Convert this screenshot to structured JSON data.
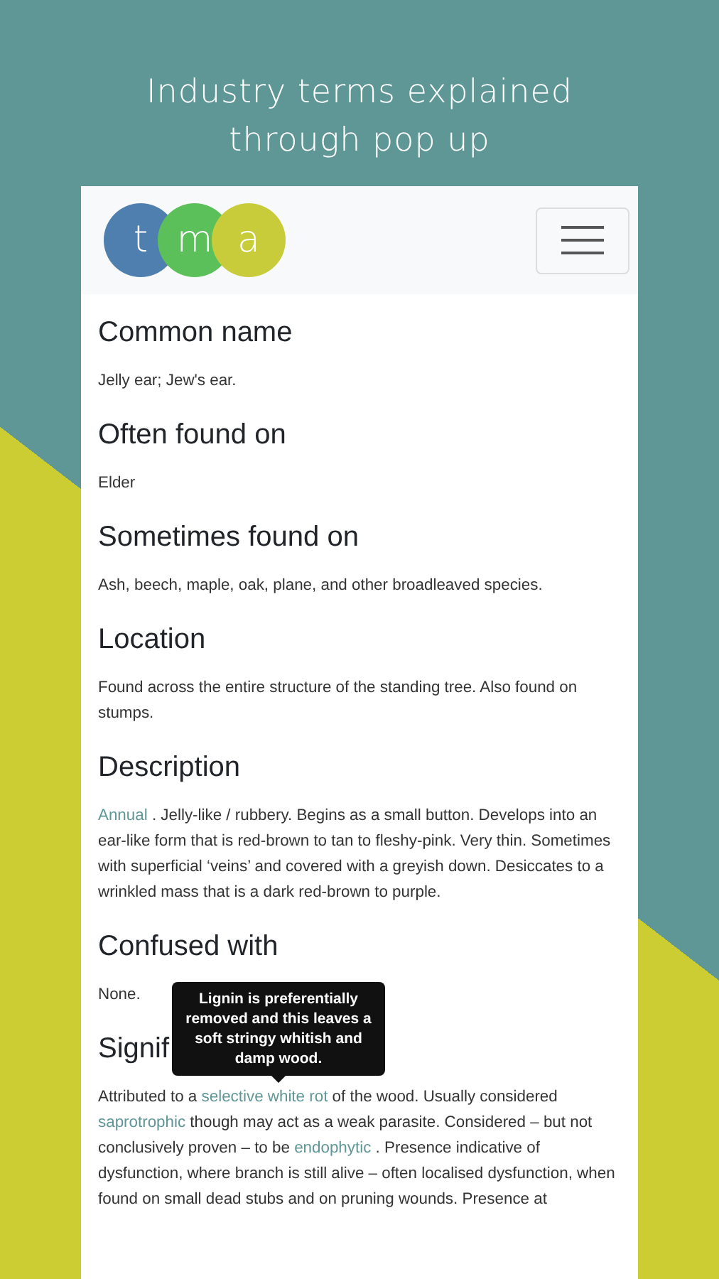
{
  "header": {
    "lines": [
      "Industry terms explained",
      "through pop up"
    ]
  },
  "logo": {
    "letters": [
      {
        "letter": "t",
        "color": "#4f7fae"
      },
      {
        "letter": "m",
        "color": "#5cc05a"
      },
      {
        "letter": "a",
        "color": "#c9cc3a"
      }
    ]
  },
  "sections": [
    {
      "heading": "Common name",
      "body": [
        {
          "text": "Jelly ear; Jew's ear.",
          "link": false
        }
      ]
    },
    {
      "heading": "Often found on",
      "body": [
        {
          "text": "Elder",
          "link": false
        }
      ]
    },
    {
      "heading": "Sometimes found on",
      "body": [
        {
          "text": "Ash, beech, maple, oak, plane, and other broadleaved species.",
          "link": false
        }
      ]
    },
    {
      "heading": "Location",
      "body": [
        {
          "text": "Found across the entire structure of the standing tree. Also found on stumps.",
          "link": false
        }
      ]
    },
    {
      "heading": "Description",
      "body": [
        {
          "text": "Annual",
          "link": true
        },
        {
          "text": " . Jelly-like / rubbery. Begins as a small button. Develops into an ear-like form that is red-brown to tan to fleshy-pink. Very thin. Sometimes with superficial ‘veins’ and covered with a greyish down. Desiccates to a wrinkled mass that is a dark red-brown to purple.",
          "link": false
        }
      ]
    },
    {
      "heading": "Confused with",
      "body": [
        {
          "text": "None.",
          "link": false
        }
      ]
    },
    {
      "heading": "Signif",
      "body": [
        {
          "text": "Attributed to a ",
          "link": false
        },
        {
          "text": "selective white rot",
          "link": true
        },
        {
          "text": " of the wood. Usually considered ",
          "link": false
        },
        {
          "text": "saprotrophic",
          "link": true
        },
        {
          "text": " though may act as a weak parasite. Considered – but not conclusively proven – to be ",
          "link": false
        },
        {
          "text": "endophytic",
          "link": true
        },
        {
          "text": " . Presence indicative of dysfunction, where branch is still alive – often localised dysfunction, when found on small dead stubs and on pruning wounds. Presence at",
          "link": false
        }
      ]
    }
  ],
  "tooltip": {
    "text": "Lignin is preferentially removed and this leaves a soft stringy whitish and damp wood."
  }
}
